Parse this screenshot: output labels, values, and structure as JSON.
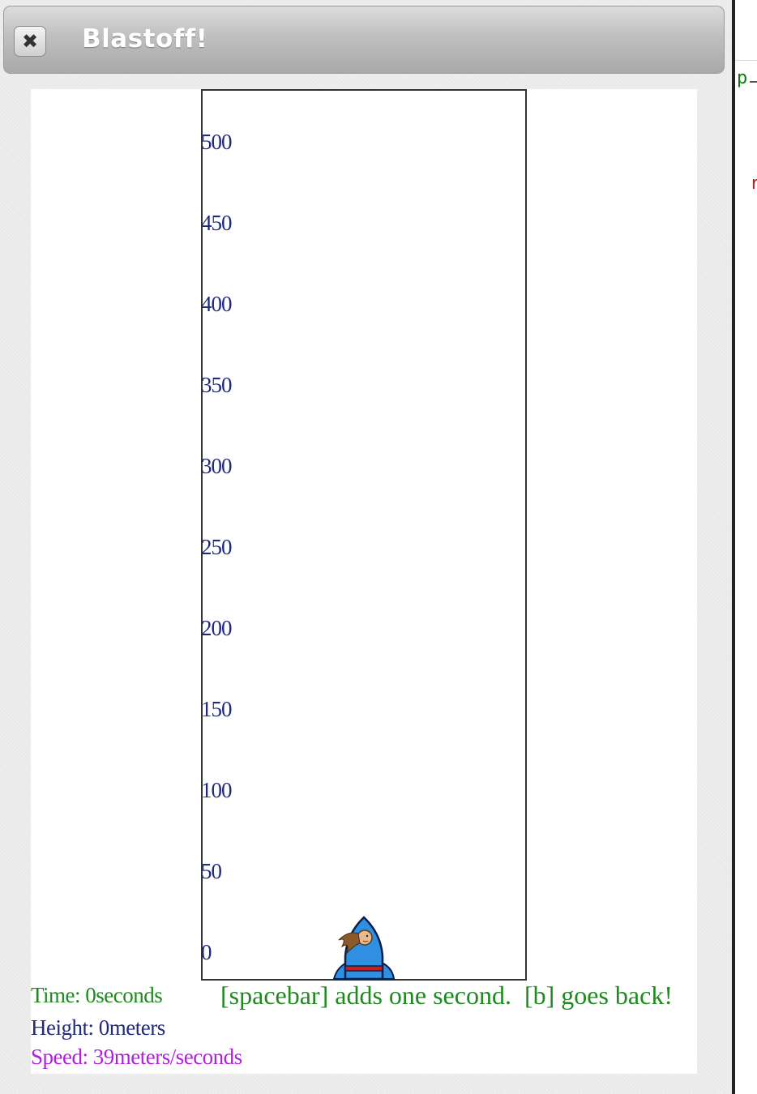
{
  "window": {
    "title": "Blastoff!",
    "close_icon": "close-icon"
  },
  "background_fragments": {
    "top": "p",
    "bottom": "r"
  },
  "scale": {
    "ticks": [
      "500",
      "450",
      "400",
      "350",
      "300",
      "250",
      "200",
      "150",
      "100",
      "50",
      "0"
    ],
    "unit": "meters"
  },
  "rocket": {
    "icon": "rocket-icon",
    "height_fraction": 0,
    "colors": {
      "body": "#2f8fe0",
      "band": "#c81e1e",
      "outline": "#0a1e4a"
    }
  },
  "readouts": {
    "time": "Time: 0seconds",
    "height": "Height: 0meters",
    "speed": "Speed: 39meters/seconds"
  },
  "instructions": "[spacebar] adds one second.  [b] goes back!",
  "colors": {
    "time": "#1e8a1e",
    "height": "#1f2a7a",
    "speed": "#b21fdc",
    "instructions": "#1e8a1e",
    "ticks": "#1f2a7a",
    "title": "#ffffff"
  }
}
